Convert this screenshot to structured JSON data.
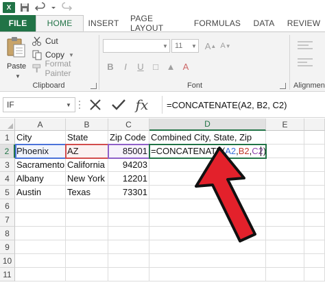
{
  "app": {
    "logo": "X",
    "accent": "#217346"
  },
  "quick_access": {
    "icons": [
      "excel-logo-icon",
      "save-icon",
      "undo-icon",
      "undo-dropdown-icon",
      "redo-icon"
    ]
  },
  "ribbon": {
    "tabs": [
      {
        "label": "FILE",
        "kind": "file"
      },
      {
        "label": "HOME",
        "kind": "active"
      },
      {
        "label": "INSERT",
        "kind": "normal"
      },
      {
        "label": "PAGE LAYOUT",
        "kind": "normal"
      },
      {
        "label": "FORMULAS",
        "kind": "normal"
      },
      {
        "label": "DATA",
        "kind": "normal"
      },
      {
        "label": "REVIEW",
        "kind": "normal"
      }
    ],
    "clipboard": {
      "paste_label": "Paste",
      "cut_label": "Cut",
      "copy_label": "Copy",
      "format_painter_label": "Format Painter",
      "group_label": "Clipboard"
    },
    "font": {
      "font_size": "11",
      "group_label": "Font"
    },
    "alignment": {
      "group_label": "Alignment"
    }
  },
  "formula_bar": {
    "name_box": "IF",
    "fx_label": "fx",
    "formula": "=CONCATENATE(A2, B2, C2)"
  },
  "grid": {
    "columns": [
      "A",
      "B",
      "C",
      "D",
      "E"
    ],
    "rows": [
      "1",
      "2",
      "3",
      "4",
      "5",
      "6",
      "7",
      "8",
      "9",
      "10",
      "11"
    ],
    "active_cell": "D2",
    "cells": {
      "A1": "City",
      "B1": "State",
      "C1": "Zip Code",
      "D1": "Combined City, State, Zip",
      "A2": "Phoenix",
      "B2": "AZ",
      "C2": "85001",
      "A3": "Sacramento",
      "B3": "California",
      "C3": "94203",
      "A4": "Albany",
      "B4": "New York",
      "C4": "12201",
      "A5": "Austin",
      "B5": "Texas",
      "C5": "73301"
    },
    "d2_formula_parts": {
      "prefix": "=CONCATENATE(",
      "ref1": "A2",
      "sep1": ", ",
      "ref2": "B2",
      "sep2": ", ",
      "ref3": "C2",
      "suffix": ")"
    }
  },
  "annotation": {
    "arrow_color": "#e3212b",
    "arrow_outline": "#111111"
  }
}
